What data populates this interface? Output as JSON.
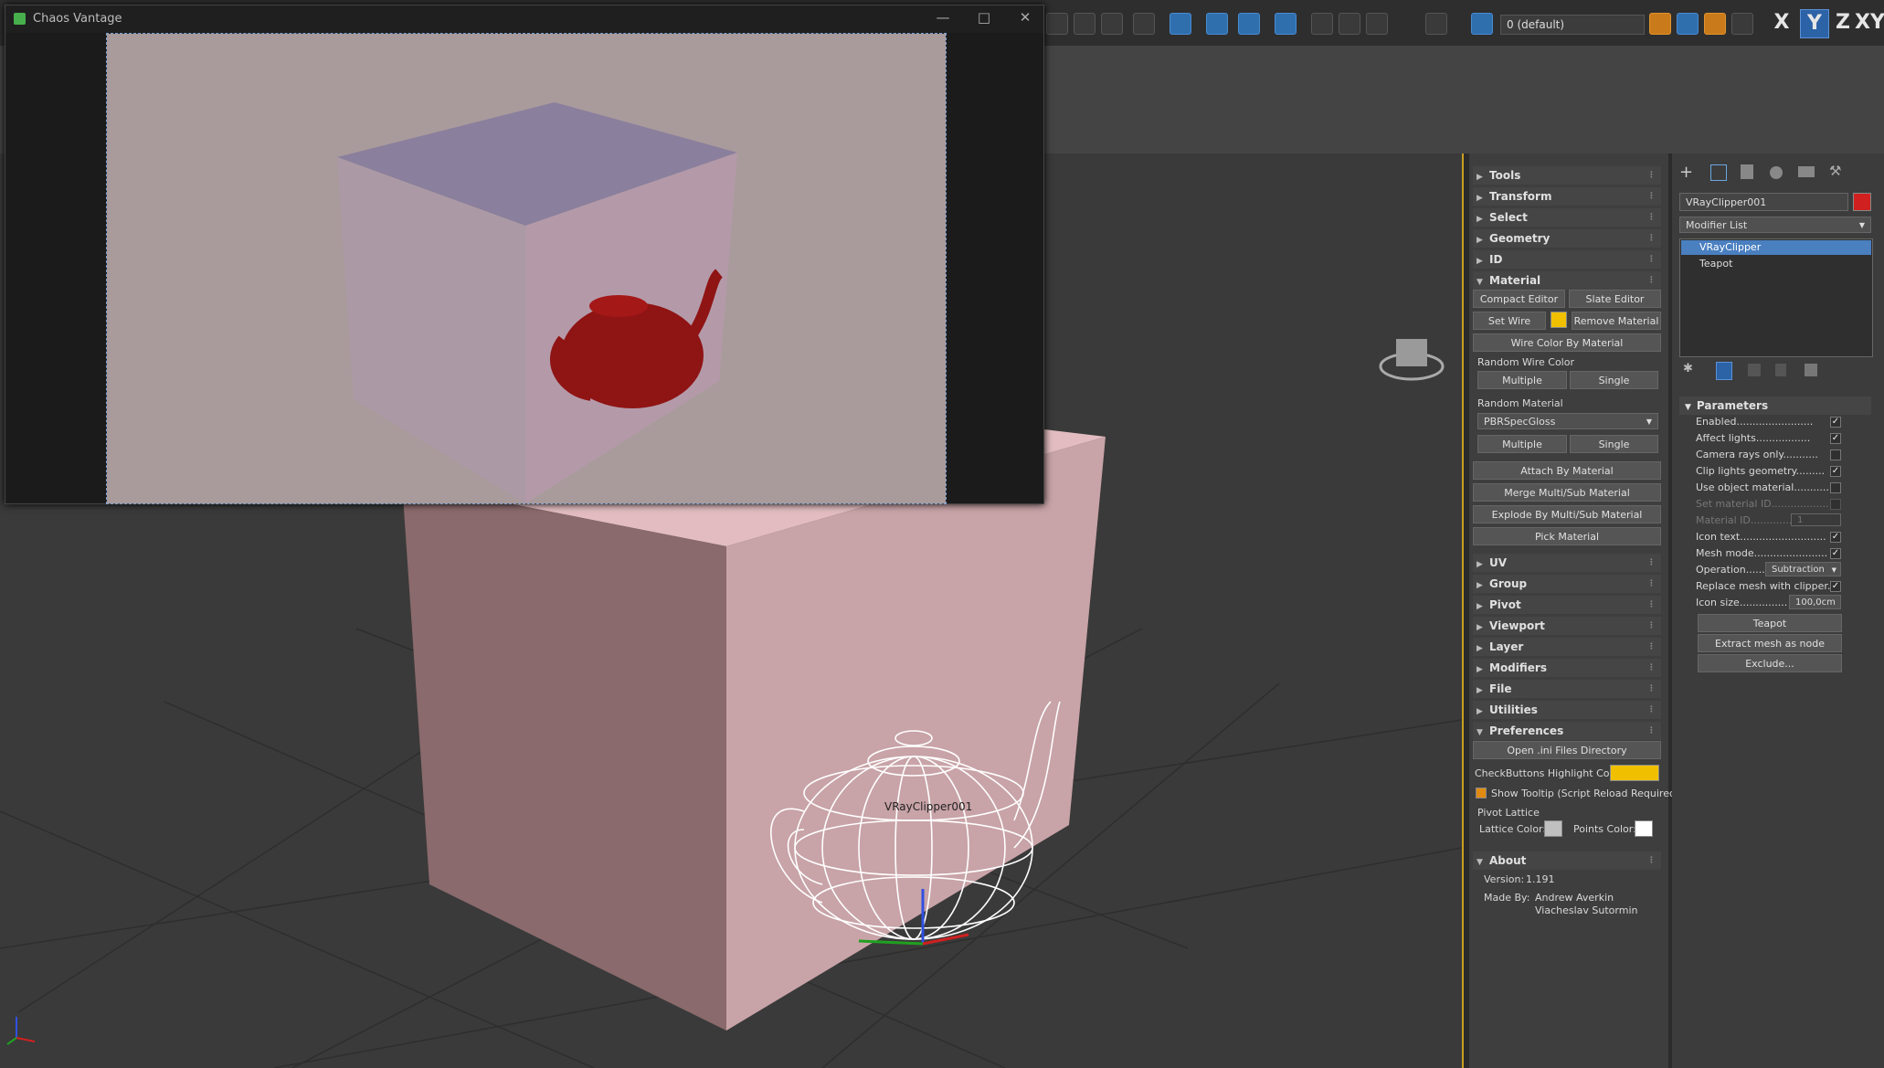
{
  "toolbar": {
    "layer_dropdown": "0 (default)",
    "axis_buttons": [
      "X",
      "Y",
      "Z",
      "XY"
    ],
    "active_axis": "Y"
  },
  "vantage": {
    "title": "Chaos Vantage"
  },
  "viewport": {
    "object_label": "VRayClipper001"
  },
  "tools_panel": {
    "rollouts_top": [
      "Tools",
      "Transform",
      "Select",
      "Geometry",
      "ID",
      "Material"
    ],
    "material": {
      "compact_editor": "Compact Editor",
      "slate_editor": "Slate Editor",
      "set_wire_color": "Set Wire Color",
      "remove_material": "Remove Material",
      "wire_color_by_material": "Wire Color By Material",
      "random_wire_color": "Random Wire Color",
      "multiple": "Multiple",
      "single": "Single",
      "random_material": "Random Material",
      "pbr_dropdown": "PBRSpecGloss",
      "attach_by_material": "Attach By Material",
      "merge_multisub": "Merge Multi/Sub Material",
      "explode_multisub": "Explode By Multi/Sub Material",
      "pick_material": "Pick Material"
    },
    "rollouts_mid": [
      "UV",
      "Group",
      "Pivot",
      "Viewport",
      "Layer",
      "Modifiers",
      "File",
      "Utilities",
      "Preferences"
    ],
    "preferences": {
      "open_ini": "Open .ini Files Directory",
      "checkbuttons_highlight": "CheckButtons Highlight Color:",
      "show_tooltip": "Show Tooltip (Script Reload Required)",
      "pivot_lattice": "Pivot  Lattice",
      "lattice_color": "Lattice Color:",
      "points_color": "Points Color:"
    },
    "about": {
      "title": "About",
      "version_label": "Version:",
      "version": "1.191",
      "made_by_label": "Made By:",
      "author1": "Andrew Averkin",
      "author2": "Viacheslav Sutormin"
    },
    "colors": {
      "wire": "#f0c000",
      "highlight": "#f0c000",
      "tooltip_check": "#e08a10",
      "lattice": "#c0c0c0",
      "points": "#ffffff"
    }
  },
  "modify_panel": {
    "object_name": "VRayClipper001",
    "object_color": "#d02020",
    "modifier_list": "Modifier List",
    "stack": [
      "VRayClipper",
      "Teapot"
    ],
    "parameters_title": "Parameters",
    "params": [
      {
        "label": "Enabled",
        "checked": true,
        "dim": false
      },
      {
        "label": "Affect lights",
        "checked": true,
        "dim": false
      },
      {
        "label": "Camera rays only",
        "checked": false,
        "dim": false
      },
      {
        "label": "Clip lights geometry",
        "checked": true,
        "dim": false
      },
      {
        "label": "Use object material",
        "checked": false,
        "dim": false
      },
      {
        "label": "Set material ID",
        "checked": false,
        "dim": true
      }
    ],
    "material_id_label": "Material ID",
    "material_id_value": "1",
    "params2": [
      {
        "label": "Icon text",
        "checked": true
      },
      {
        "label": "Mesh mode",
        "checked": true
      }
    ],
    "operation_label": "Operation",
    "operation_value": "Subtraction",
    "replace_mesh_label": "Replace mesh with clipper",
    "icon_size_label": "Icon size",
    "icon_size_value": "100,0cm",
    "teapot_button": "Teapot",
    "extract_button": "Extract mesh as node",
    "exclude_button": "Exclude..."
  }
}
